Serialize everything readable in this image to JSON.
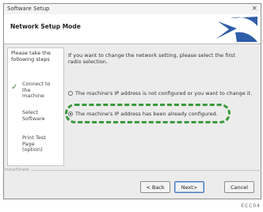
{
  "window": {
    "title": "Software Setup",
    "close_glyph": "×"
  },
  "header": {
    "title": "Network Setup Mode",
    "logo": "setup-logo-icon"
  },
  "steps": {
    "heading": "Please take the following steps",
    "items": [
      "Connect to the machine",
      "Select Software",
      "Print Test Page (option)"
    ],
    "current_index": 0
  },
  "main": {
    "intro": "If you want to change the network setting, please select the first radio selection.",
    "options": [
      {
        "label": "The machine's IP address is not configured or you want to change it.",
        "selected": false
      },
      {
        "label": "The machine's IP address has been already configured.",
        "selected": true
      }
    ]
  },
  "footer": {
    "install_label": "InstallShield",
    "back_label": "< Back",
    "next_label": "Next>",
    "cancel_label": "Cancel"
  },
  "caption": "ECC04",
  "colors": {
    "highlight": "#3c9a3c",
    "logo_blue": "#2f5ea8"
  }
}
